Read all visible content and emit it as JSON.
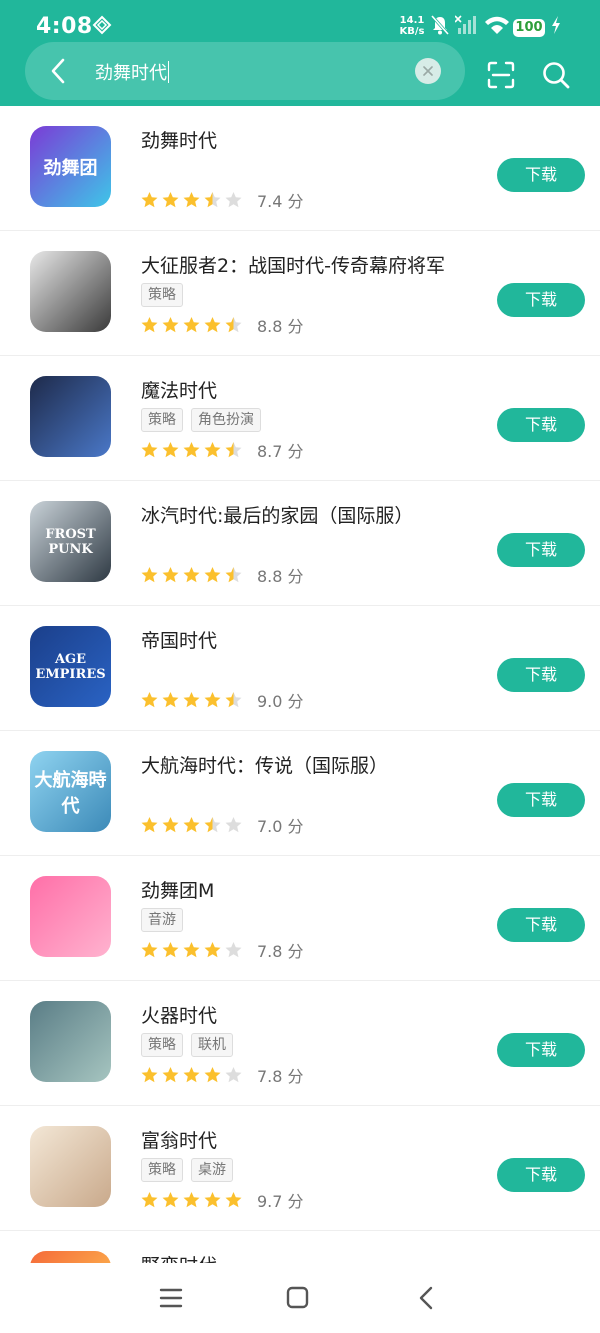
{
  "status_bar": {
    "time": "4:08",
    "net_speed_value": "14.1",
    "net_speed_unit": "KB/s",
    "battery": "100"
  },
  "search": {
    "query": "劲舞时代"
  },
  "apps": [
    {
      "name": "劲舞时代",
      "tags": [],
      "rating": 3.5,
      "score": "7.4 分",
      "icon_text": "劲舞团",
      "download": "下载"
    },
    {
      "name": "大征服者2：战国时代-传奇幕府将军",
      "tags": [
        "策略"
      ],
      "rating": 4.5,
      "score": "8.8 分",
      "icon_text": "",
      "download": "下载"
    },
    {
      "name": "魔法时代",
      "tags": [
        "策略",
        "角色扮演"
      ],
      "rating": 4.5,
      "score": "8.7 分",
      "icon_text": "",
      "download": "下载"
    },
    {
      "name": "冰汽时代:最后的家园（国际服）",
      "tags": [],
      "rating": 4.5,
      "score": "8.8 分",
      "icon_text": "FROST PUNK",
      "download": "下载"
    },
    {
      "name": "帝国时代",
      "tags": [],
      "rating": 4.5,
      "score": "9.0 分",
      "icon_text": "AGE EMPIRES",
      "download": "下载"
    },
    {
      "name": "大航海时代：传说（国际服）",
      "tags": [],
      "rating": 3.5,
      "score": "7.0 分",
      "icon_text": "大航海時代",
      "download": "下载"
    },
    {
      "name": "劲舞团M",
      "tags": [
        "音游"
      ],
      "rating": 4,
      "score": "7.8 分",
      "icon_text": "",
      "download": "下载"
    },
    {
      "name": "火器时代",
      "tags": [
        "策略",
        "联机"
      ],
      "rating": 4,
      "score": "7.8 分",
      "icon_text": "",
      "download": "下载"
    },
    {
      "name": "富翁时代",
      "tags": [
        "策略",
        "桌游"
      ],
      "rating": 5,
      "score": "9.7 分",
      "icon_text": "",
      "download": "下载"
    },
    {
      "name": "野蛮时代",
      "tags": [],
      "rating": 0,
      "score": "",
      "icon_text": "",
      "download": ""
    }
  ],
  "icon_colors": [
    [
      "#7b3bd6",
      "#3ec6e8"
    ],
    [
      "#e8e8e8",
      "#3a3a3a"
    ],
    [
      "#1e2a4a",
      "#4a78c8"
    ],
    [
      "#c9d2d8",
      "#2f3a44"
    ],
    [
      "#1b3f8a",
      "#2a63c4"
    ],
    [
      "#8fd3f0",
      "#3c8ab8"
    ],
    [
      "#ff6fa8",
      "#ffb3cf"
    ],
    [
      "#5a7d86",
      "#a6c5c0"
    ],
    [
      "#f3e7d6",
      "#c9a98b"
    ],
    [
      "#f56a3a",
      "#ffcf54"
    ]
  ],
  "colors": {
    "brand": "#21b79b",
    "star": "#fbc02d",
    "star_empty": "#dddddd"
  }
}
